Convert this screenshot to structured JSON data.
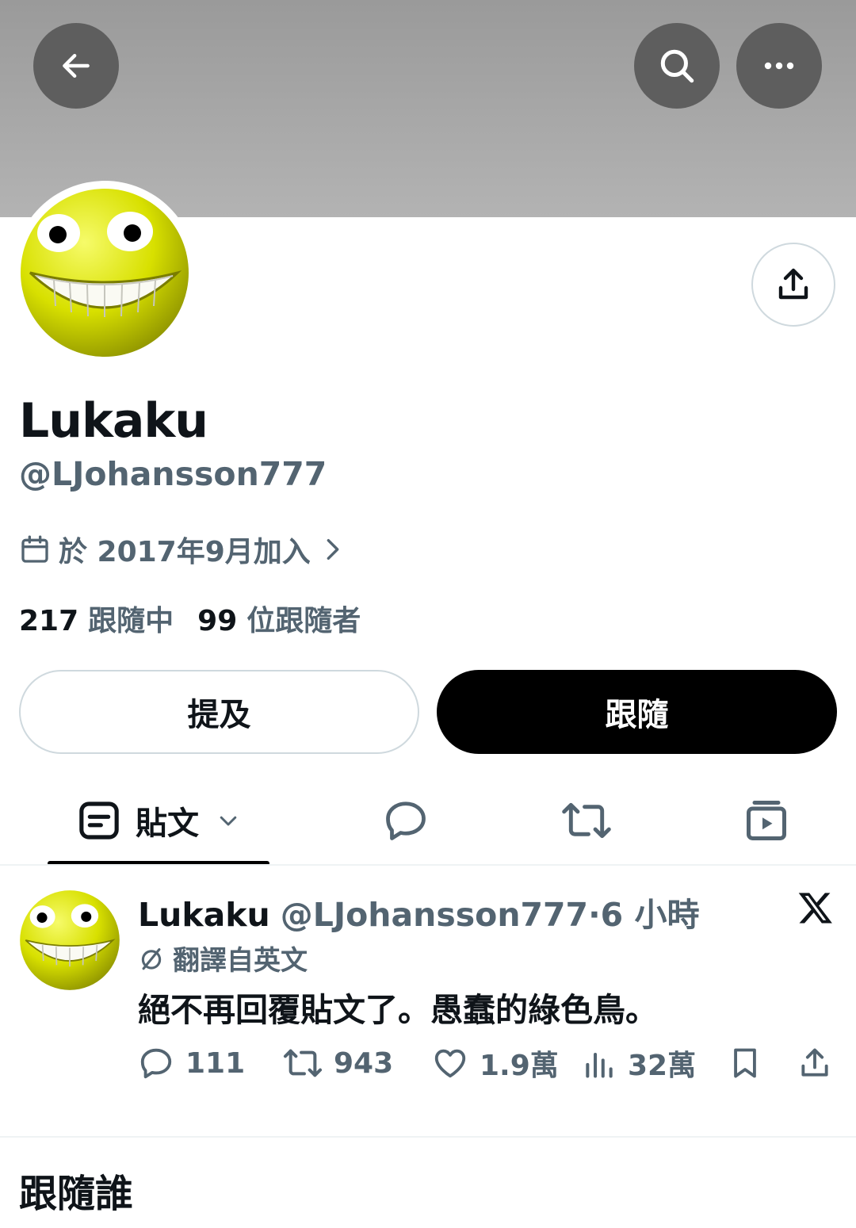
{
  "header": {
    "back_icon": "arrow-left-icon",
    "search_icon": "search-icon",
    "more_icon": "more-horizontal-icon",
    "banner_color": "#a6a6a6"
  },
  "profile": {
    "avatar_alt": "yellow grinning smiley avatar",
    "share_icon": "share-upload-icon",
    "display_name": "Lukaku",
    "handle": "@LJohansson777",
    "joined_text": "於 2017年9月加入",
    "following_count": "217",
    "following_label": "跟隨中",
    "followers_count": "99",
    "followers_label": "位跟隨者"
  },
  "buttons": {
    "mention_label": "提及",
    "follow_label": "跟隨"
  },
  "tabs": {
    "posts_label": "貼文",
    "active": "posts"
  },
  "post": {
    "author_name": "Lukaku",
    "author_handle": "@LJohansson777",
    "time_sep": "·",
    "time": "6 小時",
    "translated_label": "翻譯自英文",
    "text": "絕不再回覆貼文了。愚蠢的綠色鳥。",
    "replies": "111",
    "reposts": "943",
    "likes": "1.9萬",
    "views": "32萬"
  },
  "section": {
    "who_to_follow": "跟隨誰"
  },
  "colors": {
    "text_primary": "#0f1419",
    "text_secondary": "#536471",
    "border": "#cfd9de",
    "follow_bg": "#000000"
  }
}
